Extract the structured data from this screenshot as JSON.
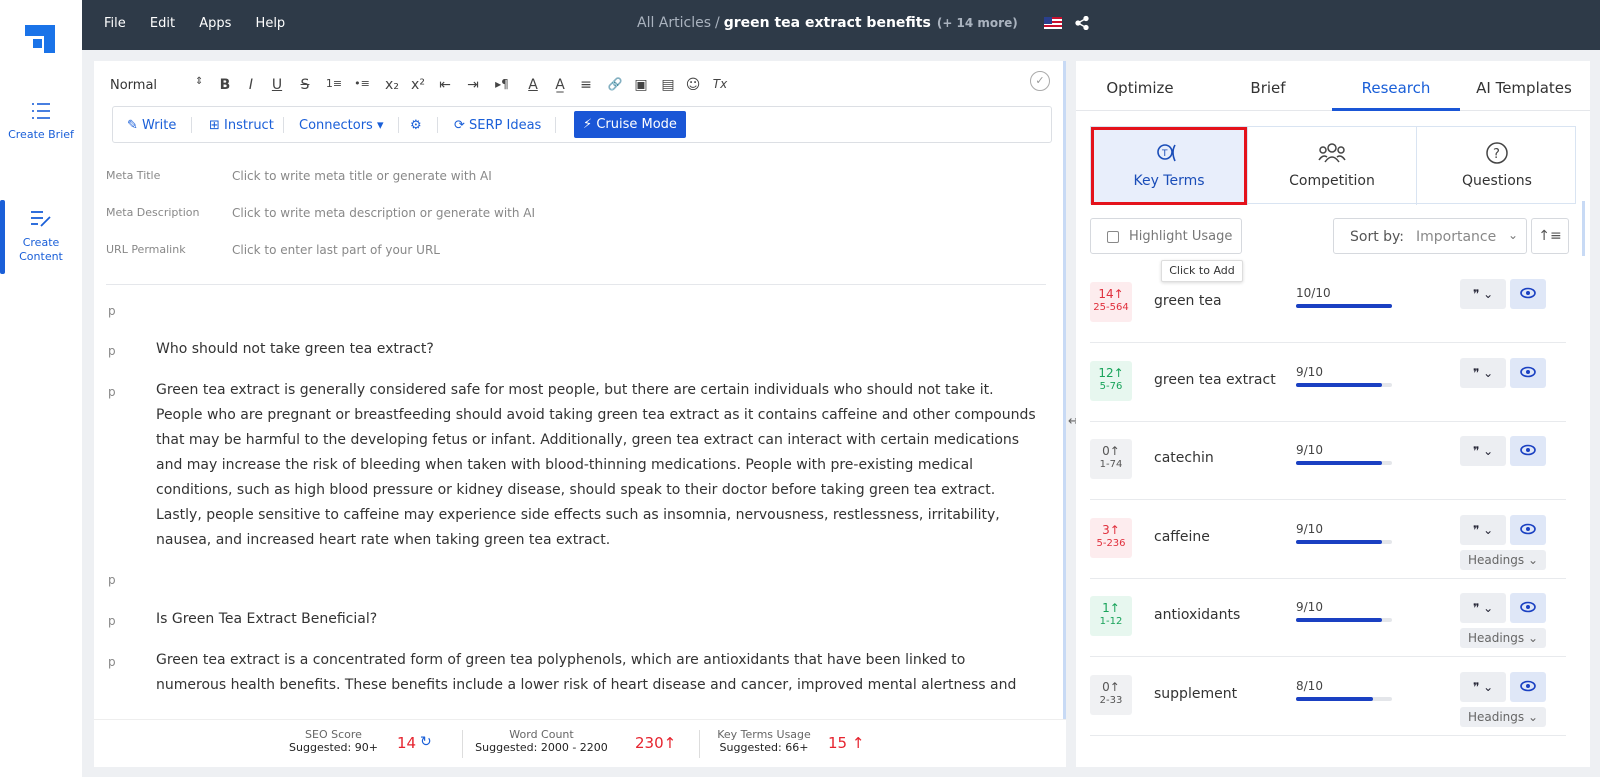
{
  "nav": {
    "create_brief": "Create Brief",
    "create_content": "Create Content"
  },
  "topbar": {
    "menu": [
      "File",
      "Edit",
      "Apps",
      "Help"
    ],
    "crumb_all": "All Articles",
    "crumb_sep": "/",
    "crumb_current": "green tea extract benefits",
    "crumb_more": "(+ 14 more)"
  },
  "toolbar": {
    "format": "Normal",
    "buttons": [
      "B",
      "I",
      "U",
      "S",
      "1≡",
      "•≡",
      "x₂",
      "x²",
      "⇤",
      "⇥",
      "▸¶",
      "A",
      "A̲",
      "≡",
      "🔗",
      "▣",
      "▤",
      "☺",
      "Tx"
    ]
  },
  "actions": {
    "write": "Write",
    "instruct": "Instruct",
    "connectors": "Connectors",
    "serp": "SERP Ideas",
    "cruise": "Cruise Mode"
  },
  "meta": {
    "title_label": "Meta Title",
    "title_value": "Click to write meta title or generate with AI",
    "desc_label": "Meta Description",
    "desc_value": "Click to write meta description or generate with AI",
    "url_label": "URL Permalink",
    "url_value": "Click to enter last part of your URL"
  },
  "content": {
    "ptag": "p",
    "h1": "Who should not take green tea extract?",
    "p1": "Green tea extract is generally considered safe for most people, but there are certain individuals who should not take it. People who are pregnant or breastfeeding should avoid taking green tea extract as it contains caffeine and other compounds that may be harmful to the developing fetus or infant. Additionally, green tea extract can interact with certain medications and may increase the risk of bleeding when taken with blood-thinning medications. People with pre-existing medical conditions, such as high blood pressure or kidney disease, should speak to their doctor before taking green tea extract. Lastly, people sensitive to caffeine may experience side effects such as insomnia, nervousness, restlessness, irritability, nausea, and increased heart rate when taking green tea extract.",
    "h2": "Is Green Tea Extract Beneficial?",
    "p2": "Green tea extract is a concentrated form of green tea polyphenols, which are antioxidants that have been linked to numerous health benefits. These benefits include a lower risk of heart disease and cancer, improved mental alertness and cognitive"
  },
  "stats": {
    "seo_label": "SEO Score",
    "seo_sugg": "Suggested: 90+",
    "seo_val": "14",
    "wc_label": "Word Count",
    "wc_sugg": "Suggested: 2000 - 2200",
    "wc_val": "230",
    "kt_label": "Key Terms Usage",
    "kt_sugg": "Suggested: 66+",
    "kt_val": "15"
  },
  "panel": {
    "tabs": [
      "Optimize",
      "Brief",
      "Research",
      "AI Templates"
    ],
    "subtabs": [
      "Key Terms",
      "Competition",
      "Questions"
    ],
    "highlight": "Highlight Usage",
    "sort_label": "Sort by:",
    "sort_value": "Importance",
    "tooltip": "Click to Add",
    "headings_label": "Headings",
    "terms": [
      {
        "count": "14",
        "range": "25-564",
        "name": "green tea",
        "score": "10/10",
        "level": 1.0,
        "color": "red",
        "headings": false
      },
      {
        "count": "12",
        "range": "5-76",
        "name": "green tea extract",
        "score": "9/10",
        "level": 0.9,
        "color": "green",
        "headings": false
      },
      {
        "count": "0",
        "range": "1-74",
        "name": "catechin",
        "score": "9/10",
        "level": 0.9,
        "color": "gray",
        "headings": false
      },
      {
        "count": "3",
        "range": "5-236",
        "name": "caffeine",
        "score": "9/10",
        "level": 0.9,
        "color": "red",
        "headings": true
      },
      {
        "count": "1",
        "range": "1-12",
        "name": "antioxidants",
        "score": "9/10",
        "level": 0.9,
        "color": "green",
        "headings": true
      },
      {
        "count": "0",
        "range": "2-33",
        "name": "supplement",
        "score": "8/10",
        "level": 0.8,
        "color": "gray",
        "headings": true
      }
    ]
  }
}
